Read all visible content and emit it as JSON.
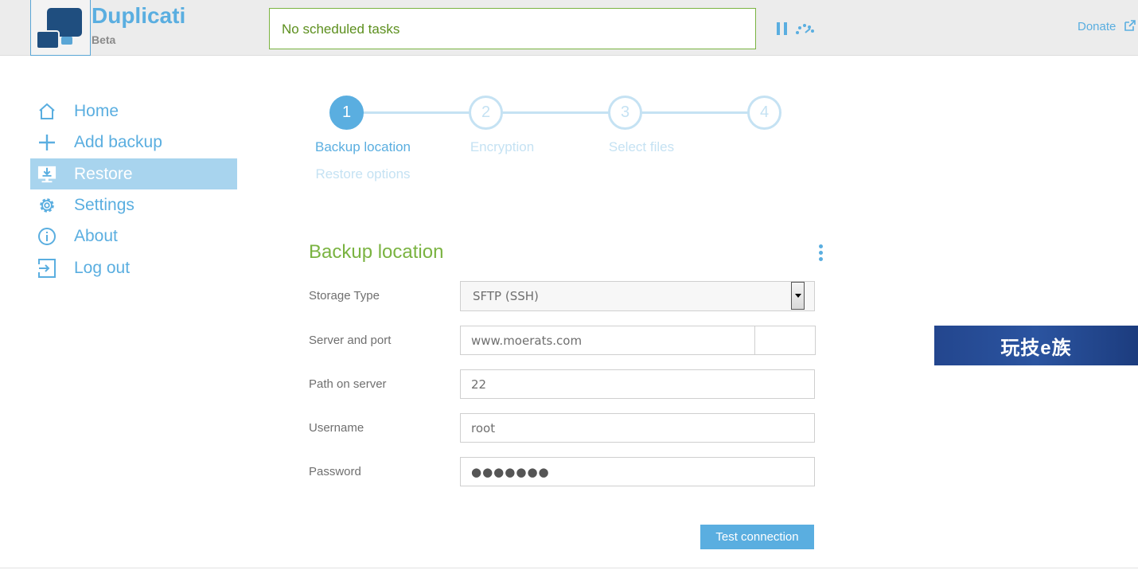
{
  "header": {
    "app_name": "Duplicati",
    "app_subtitle": "Beta",
    "status_text": "No scheduled tasks",
    "donate_label": "Donate"
  },
  "sidebar": {
    "items": [
      {
        "label": "Home",
        "icon": "home-icon"
      },
      {
        "label": "Add backup",
        "icon": "plus-icon"
      },
      {
        "label": "Restore",
        "icon": "restore-icon",
        "active": true
      },
      {
        "label": "Settings",
        "icon": "gear-icon"
      },
      {
        "label": "About",
        "icon": "info-icon"
      },
      {
        "label": "Log out",
        "icon": "logout-icon"
      }
    ]
  },
  "steps": {
    "numbers": [
      "1",
      "2",
      "3",
      "4"
    ],
    "labels": [
      "Backup location",
      "Encryption",
      "Select files",
      "Restore options"
    ],
    "active_index": 0
  },
  "form": {
    "section_title": "Backup location",
    "storage_type_label": "Storage Type",
    "storage_type_value": "SFTP (SSH)",
    "server_label": "Server and port",
    "server_value": "www.moerats.com",
    "port_value": "",
    "path_label": "Path on server",
    "path_value": "22",
    "username_label": "Username",
    "username_value": "root",
    "password_label": "Password",
    "password_value": "●●●●●●●",
    "test_button": "Test connection"
  },
  "banner": {
    "text": "玩技e族"
  },
  "colors": {
    "accent": "#5aaee0",
    "green": "#7ab341",
    "active_nav": "#a8d4ee",
    "inactive_step": "#c5e2f3"
  }
}
